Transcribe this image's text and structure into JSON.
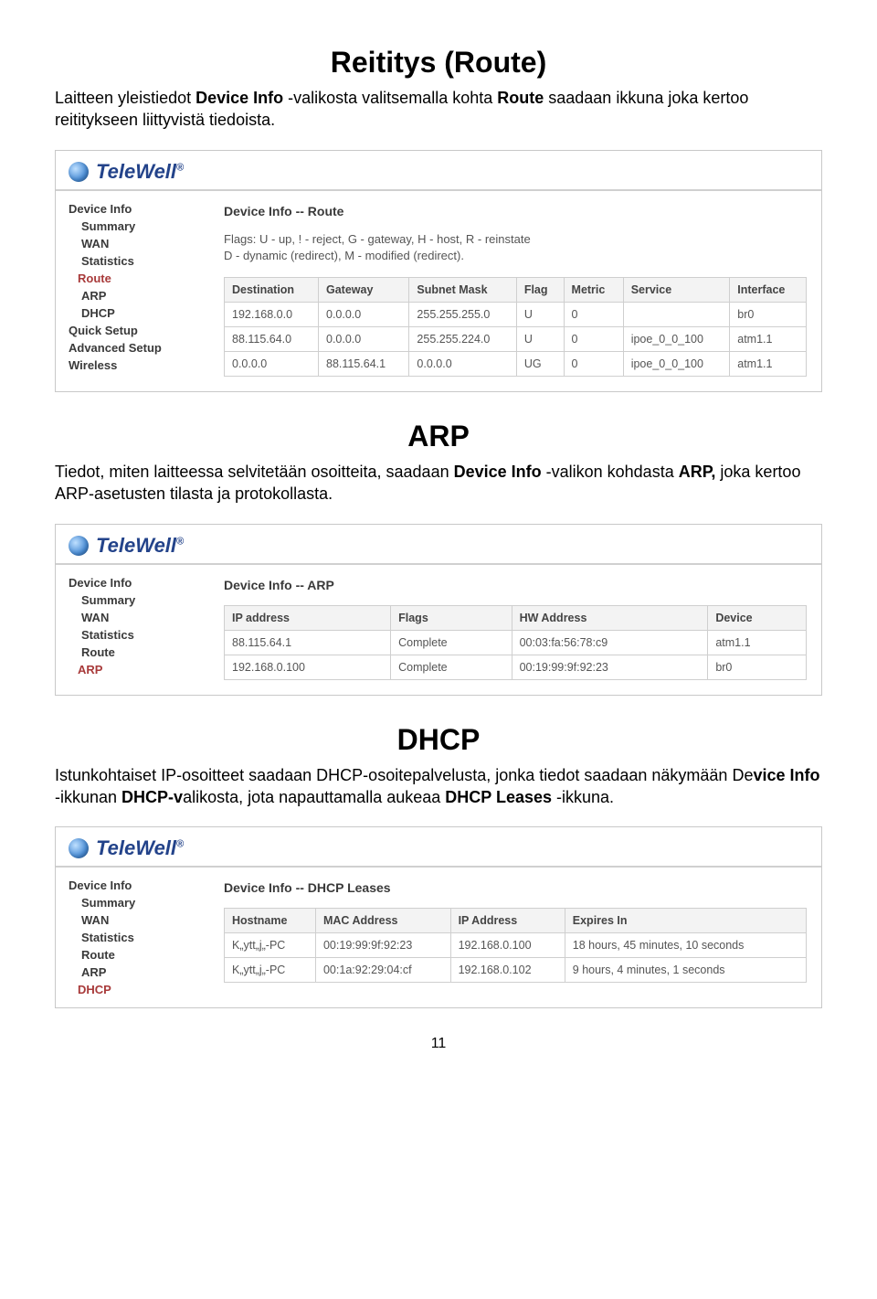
{
  "sections": {
    "route": {
      "title": "Reititys (Route)",
      "para_parts": [
        "Laitteen yleistiedot ",
        "Device Info",
        " -valikosta valitsemalla kohta ",
        "Route",
        " saadaan ikkuna joka kertoo reititykseen liittyvistä tiedoista."
      ]
    },
    "arp": {
      "title": "ARP",
      "para_parts": [
        "Tiedot, miten laitteessa selvitetään osoitteita, saadaan ",
        "Device Info",
        " -valikon kohdasta ",
        "ARP,",
        " joka kertoo ARP-asetusten tilasta ja protokollasta."
      ]
    },
    "dhcp": {
      "title": "DHCP",
      "para_parts": [
        "Istunkohtaiset IP-osoitteet saadaan DHCP-osoitepalvelusta, jonka tiedot saadaan näkymään De",
        "vice Info",
        " -ikkunan ",
        "DHCP-v",
        "alikosta, jota napauttamalla aukeaa ",
        "DHCP Leases",
        " -ikkuna."
      ]
    }
  },
  "logo": "TeleWell",
  "panel_route": {
    "nav": [
      "Device Info",
      "Summary",
      "WAN",
      "Statistics",
      "Route",
      "ARP",
      "DHCP",
      "Quick Setup",
      "Advanced Setup",
      "Wireless"
    ],
    "nav_selected": "Route",
    "content_title": "Device Info -- Route",
    "flags_l1": "Flags: U - up, ! - reject, G - gateway, H - host, R - reinstate",
    "flags_l2": "D - dynamic (redirect), M - modified (redirect).",
    "headers": [
      "Destination",
      "Gateway",
      "Subnet Mask",
      "Flag",
      "Metric",
      "Service",
      "Interface"
    ],
    "rows": [
      [
        "192.168.0.0",
        "0.0.0.0",
        "255.255.255.0",
        "U",
        "0",
        "",
        "br0"
      ],
      [
        "88.115.64.0",
        "0.0.0.0",
        "255.255.224.0",
        "U",
        "0",
        "ipoe_0_0_100",
        "atm1.1"
      ],
      [
        "0.0.0.0",
        "88.115.64.1",
        "0.0.0.0",
        "UG",
        "0",
        "ipoe_0_0_100",
        "atm1.1"
      ]
    ]
  },
  "panel_arp": {
    "nav": [
      "Device Info",
      "Summary",
      "WAN",
      "Statistics",
      "Route",
      "ARP"
    ],
    "nav_selected": "ARP",
    "content_title": "Device Info -- ARP",
    "headers": [
      "IP address",
      "Flags",
      "HW Address",
      "Device"
    ],
    "rows": [
      [
        "88.115.64.1",
        "Complete",
        "00:03:fa:56:78:c9",
        "atm1.1"
      ],
      [
        "192.168.0.100",
        "Complete",
        "00:19:99:9f:92:23",
        "br0"
      ]
    ]
  },
  "panel_dhcp": {
    "nav": [
      "Device Info",
      "Summary",
      "WAN",
      "Statistics",
      "Route",
      "ARP",
      "DHCP"
    ],
    "nav_selected": "DHCP",
    "content_title": "Device Info -- DHCP Leases",
    "headers": [
      "Hostname",
      "MAC Address",
      "IP Address",
      "Expires In"
    ],
    "rows": [
      [
        "K„ytt„j„-PC",
        "00:19:99:9f:92:23",
        "192.168.0.100",
        "18 hours, 45 minutes, 10 seconds"
      ],
      [
        "K„ytt„j„-PC",
        "00:1a:92:29:04:cf",
        "192.168.0.102",
        "9 hours, 4 minutes, 1 seconds"
      ]
    ]
  },
  "pagenum": "11"
}
